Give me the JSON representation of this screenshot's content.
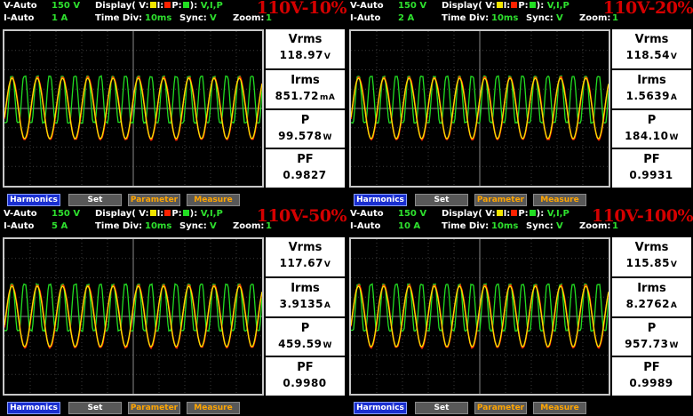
{
  "labels": {
    "v_auto": "V-Auto",
    "i_auto": "I-Auto",
    "display": "Display( V:",
    "i_sep": "I:",
    "p_sep": "P:",
    "display_end": "):",
    "display_channels": "V,I,P",
    "time_div": "Time Div:",
    "sync": "Sync:",
    "zoom": "Zoom:"
  },
  "colors": {
    "voltage": "#f2e500",
    "current": "#ff2200",
    "power": "#22dd22"
  },
  "buttons": {
    "harmonics": "Harmonics",
    "set": "Set",
    "parameter": "Parameter",
    "measure": "Measure"
  },
  "panels": [
    {
      "tag": "110V-10%",
      "v_range": "150 V",
      "i_range": "1 A",
      "time_div": "10ms",
      "sync": "V",
      "zoom": "1",
      "measurements": [
        {
          "name": "Vrms",
          "value": "118.97",
          "unit": "V"
        },
        {
          "name": "Irms",
          "value": "851.72",
          "unit": "mA"
        },
        {
          "name": "P",
          "value": "99.578",
          "unit": "W"
        },
        {
          "name": "PF",
          "value": "0.9827",
          "unit": ""
        }
      ]
    },
    {
      "tag": "110V-20%",
      "v_range": "150 V",
      "i_range": "2 A",
      "time_div": "10ms",
      "sync": "V",
      "zoom": "1",
      "measurements": [
        {
          "name": "Vrms",
          "value": "118.54",
          "unit": "V"
        },
        {
          "name": "Irms",
          "value": "1.5639",
          "unit": "A"
        },
        {
          "name": "P",
          "value": "184.10",
          "unit": "W"
        },
        {
          "name": "PF",
          "value": "0.9931",
          "unit": ""
        }
      ]
    },
    {
      "tag": "110V-50%",
      "v_range": "150 V",
      "i_range": "5 A",
      "time_div": "10ms",
      "sync": "V",
      "zoom": "1",
      "measurements": [
        {
          "name": "Vrms",
          "value": "117.67",
          "unit": "V"
        },
        {
          "name": "Irms",
          "value": "3.9135",
          "unit": "A"
        },
        {
          "name": "P",
          "value": "459.59",
          "unit": "W"
        },
        {
          "name": "PF",
          "value": "0.9980",
          "unit": ""
        }
      ]
    },
    {
      "tag": "110V-100%",
      "v_range": "150 V",
      "i_range": "10 A",
      "time_div": "10ms",
      "sync": "V",
      "zoom": "1",
      "measurements": [
        {
          "name": "Vrms",
          "value": "115.85",
          "unit": "V"
        },
        {
          "name": "Irms",
          "value": "8.2762",
          "unit": "A"
        },
        {
          "name": "P",
          "value": "957.73",
          "unit": "W"
        },
        {
          "name": "PF",
          "value": "0.9989",
          "unit": ""
        }
      ]
    }
  ]
}
